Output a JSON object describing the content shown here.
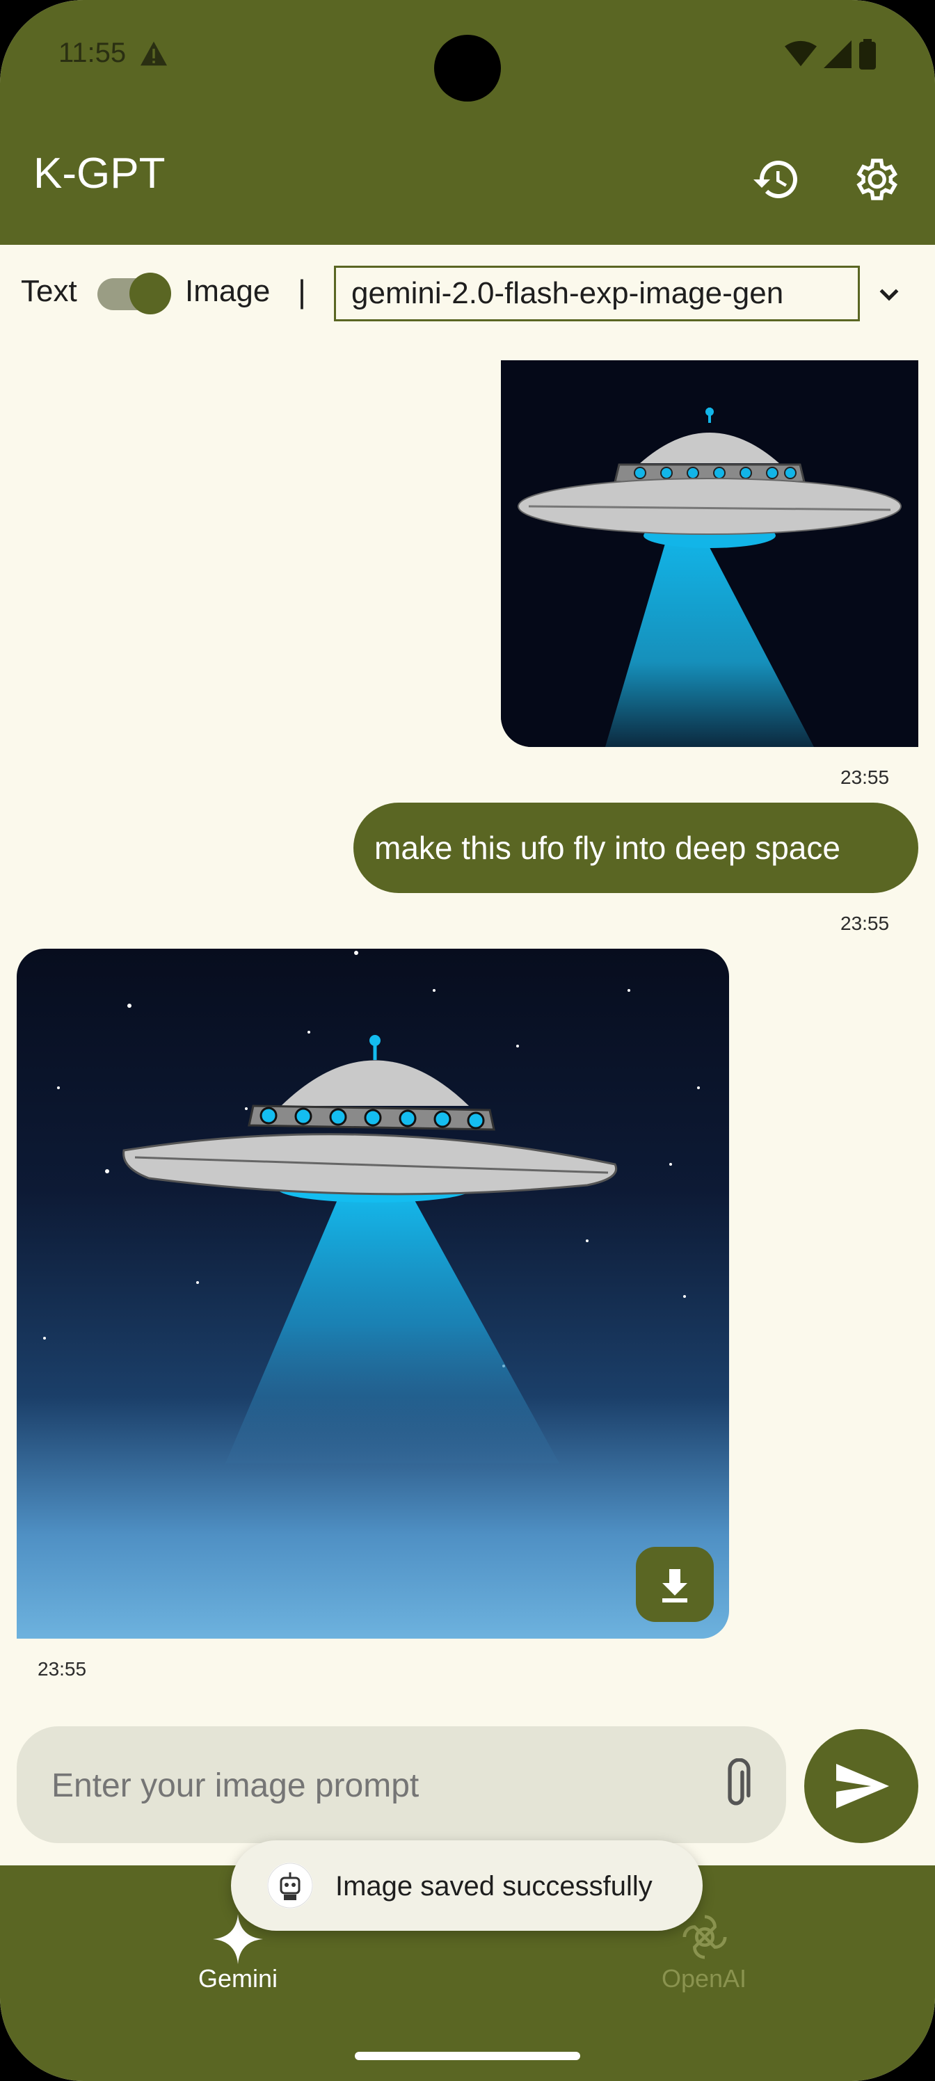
{
  "status_bar": {
    "time": "11:55"
  },
  "app_bar": {
    "title": "K-GPT",
    "icons": [
      "history-icon",
      "settings-icon"
    ]
  },
  "mode": {
    "text_label": "Text",
    "image_label": "Image",
    "separator": "|",
    "toggle_on": true,
    "model": "gemini-2.0-flash-exp-image-gen"
  },
  "messages": [
    {
      "role": "user",
      "type": "image",
      "timestamp": "23:55"
    },
    {
      "role": "user",
      "type": "text",
      "text": "make this ufo fly into deep space",
      "timestamp": "23:55"
    },
    {
      "role": "assistant",
      "type": "image",
      "timestamp": "23:55"
    }
  ],
  "input": {
    "placeholder": "Enter your image prompt"
  },
  "snackbar": {
    "text": "Image saved successfully"
  },
  "bottom_nav": [
    {
      "label": "Gemini",
      "icon": "sparkle-icon",
      "active": true
    },
    {
      "label": "OpenAI",
      "icon": "openai-icon",
      "active": false
    }
  ],
  "colors": {
    "primary": "#5a6623",
    "background": "#fbf9ec",
    "beam": "#12b5e8"
  }
}
